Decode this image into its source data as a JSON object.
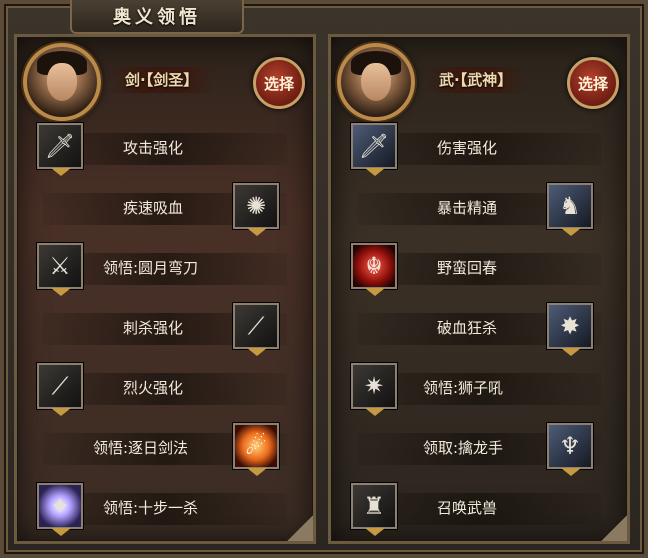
{
  "window": {
    "title": "奥义领悟"
  },
  "left": {
    "class_label": "剑·【剑圣】",
    "select_label": "选择",
    "skills": [
      {
        "label": "攻击强化",
        "icon": "sword-icon",
        "side": "left"
      },
      {
        "label": "疾速吸血",
        "icon": "swirl-blades-icon",
        "side": "right"
      },
      {
        "label": "领悟:圆月弯刀",
        "icon": "crescent-blade-icon",
        "side": "left"
      },
      {
        "label": "刺杀强化",
        "icon": "thrust-blade-icon",
        "side": "right"
      },
      {
        "label": "烈火强化",
        "icon": "flame-blade-icon",
        "side": "left"
      },
      {
        "label": "领悟:逐日剑法",
        "icon": "fire-slash-icon",
        "side": "right"
      },
      {
        "label": "领悟:十步一杀",
        "icon": "spirit-orb-icon",
        "side": "left"
      }
    ]
  },
  "right": {
    "class_label": "武·【武神】",
    "select_label": "选择",
    "skills": [
      {
        "label": "伤害强化",
        "icon": "sword-icon",
        "side": "left"
      },
      {
        "label": "暴击精通",
        "icon": "muscle-figure-icon",
        "side": "right"
      },
      {
        "label": "野蛮回春",
        "icon": "red-dragon-icon",
        "side": "left"
      },
      {
        "label": "破血狂杀",
        "icon": "shatter-icon",
        "side": "right"
      },
      {
        "label": "领悟:狮子吼",
        "icon": "burst-icon",
        "side": "left"
      },
      {
        "label": "领取:擒龙手",
        "icon": "dragon-claw-icon",
        "side": "right"
      },
      {
        "label": "召唤武兽",
        "icon": "beast-warrior-icon",
        "side": "left"
      }
    ]
  }
}
